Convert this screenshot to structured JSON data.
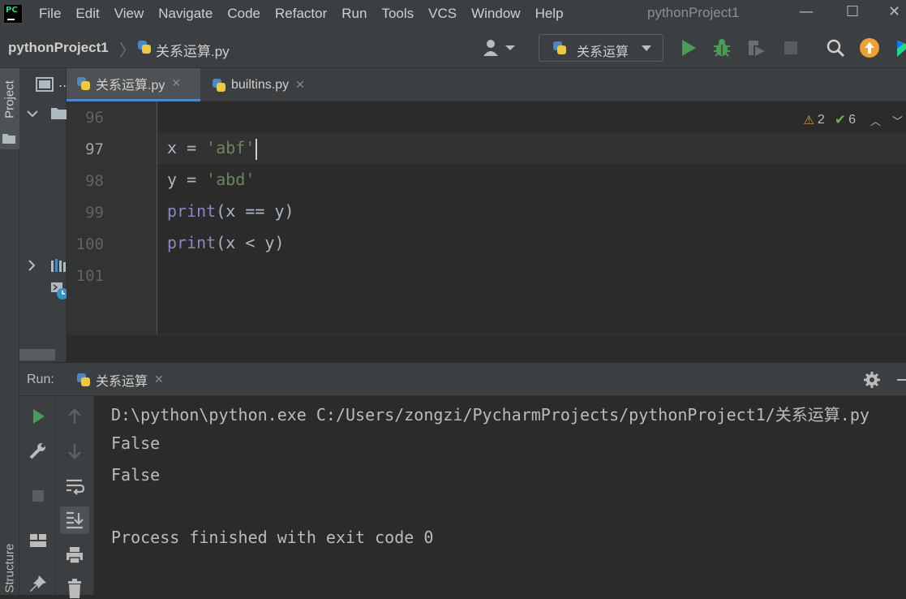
{
  "app": {
    "logo_text": "PC",
    "window_title": "pythonProject1"
  },
  "menu": [
    "File",
    "Edit",
    "View",
    "Navigate",
    "Code",
    "Refactor",
    "Run",
    "Tools",
    "VCS",
    "Window",
    "Help"
  ],
  "window_controls": {
    "minimize": "—",
    "maximize": "☐",
    "close": "✕"
  },
  "breadcrumb": {
    "project": "pythonProject1",
    "separator": "〉",
    "file": "关系运算.py"
  },
  "run_configuration": {
    "label": "关系运算"
  },
  "side_tabs": {
    "project": "Project",
    "structure": "Structure"
  },
  "editor_tabs": [
    {
      "label": "关系运算.py",
      "active": true,
      "close": "✕"
    },
    {
      "label": "builtins.py",
      "active": false,
      "close": "✕"
    }
  ],
  "project_tab_label": "..",
  "inspections": {
    "warnings": "2",
    "ok": "6",
    "warn_icon": "⚠",
    "ok_icon": "✔",
    "up": "︿",
    "down": "﹀"
  },
  "editor": {
    "line_numbers": [
      "96",
      "97",
      "98",
      "99",
      "100",
      "101"
    ],
    "current_line": "97",
    "lines": [
      {
        "tokens": []
      },
      {
        "tokens": [
          {
            "t": "x = ",
            "c": "plain"
          },
          {
            "t": "'abf'",
            "c": "str"
          }
        ]
      },
      {
        "tokens": [
          {
            "t": "y = ",
            "c": "plain"
          },
          {
            "t": "'abd'",
            "c": "str"
          }
        ]
      },
      {
        "tokens": [
          {
            "t": "print",
            "c": "fn"
          },
          {
            "t": "(x == y)",
            "c": "plain"
          }
        ]
      },
      {
        "tokens": [
          {
            "t": "print",
            "c": "fn"
          },
          {
            "t": "(x < y)",
            "c": "plain"
          }
        ]
      },
      {
        "tokens": []
      }
    ]
  },
  "run_panel": {
    "label": "Run:",
    "tab_label": "关系运算",
    "tab_close": "✕",
    "console": [
      "D:\\python\\python.exe C:/Users/zongzi/PycharmProjects/pythonProject1/关系运算.py",
      "False",
      "False",
      "",
      "Process finished with exit code 0"
    ]
  },
  "colors": {
    "accent_green": "#499c54",
    "string": "#6a8759",
    "builtin": "#8888c6",
    "tab_underline": "#4a88c7",
    "update_orange": "#f0a030"
  }
}
